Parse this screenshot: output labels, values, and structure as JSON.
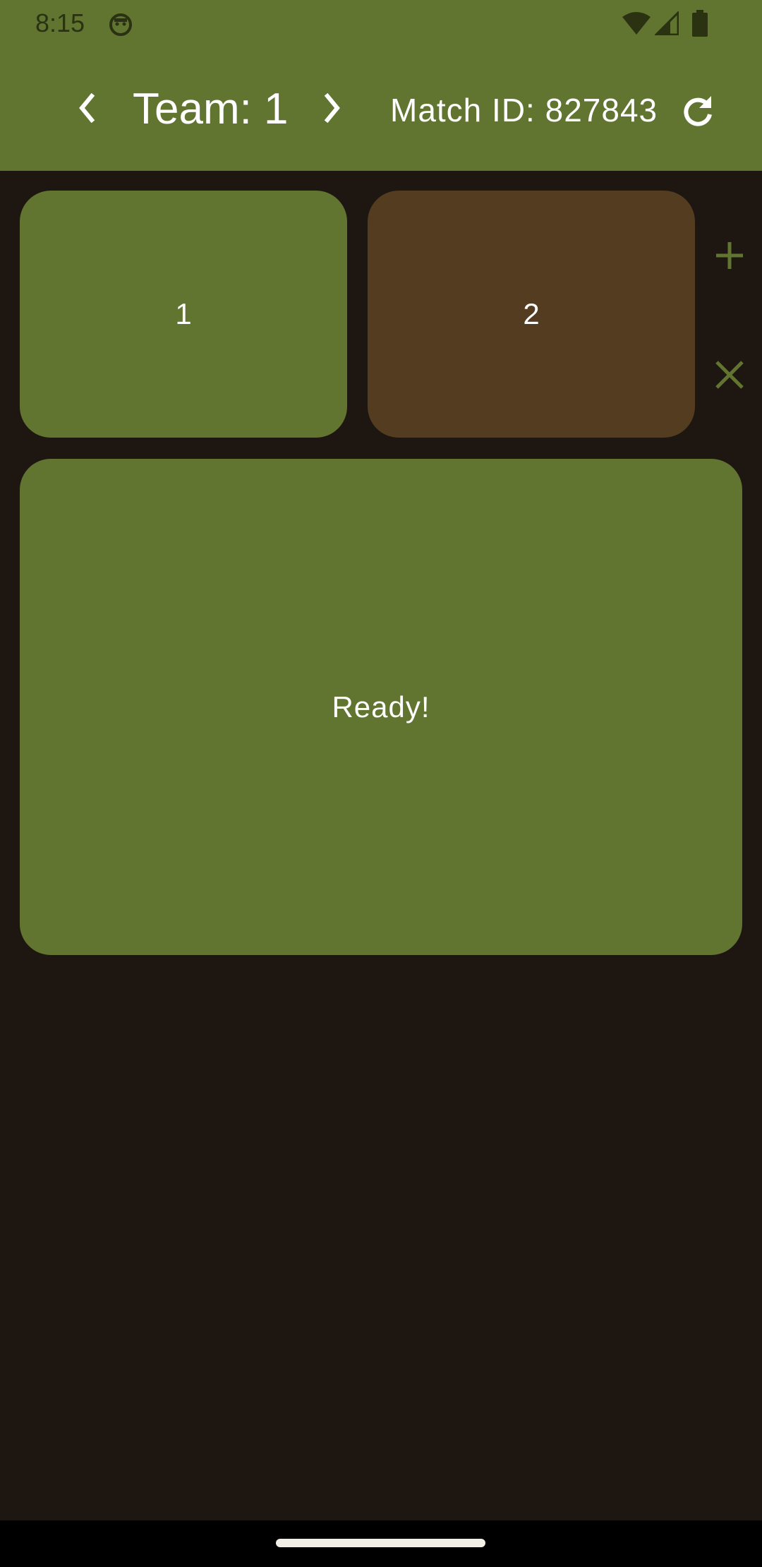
{
  "status_bar": {
    "time": "8:15",
    "icons": [
      "face-notification-icon",
      "wifi-icon",
      "signal-icon",
      "battery-icon"
    ]
  },
  "header": {
    "prev_icon": "chevron-left-icon",
    "team_title": "Team: 1",
    "next_icon": "chevron-right-icon",
    "match_label": "Match ID: 827843",
    "refresh_icon": "refresh-icon"
  },
  "teams": [
    {
      "label": "1",
      "color": "#617531"
    },
    {
      "label": "2",
      "color": "#533c1f"
    }
  ],
  "side_actions": {
    "add_icon": "plus-icon",
    "remove_icon": "close-icon",
    "icon_color": "#617531"
  },
  "ready_panel": {
    "label": "Ready!",
    "color": "#617531"
  },
  "colors": {
    "primary": "#617531",
    "background": "#1e1610",
    "secondary_tile": "#533c1f",
    "on_primary": "#ffffff"
  }
}
